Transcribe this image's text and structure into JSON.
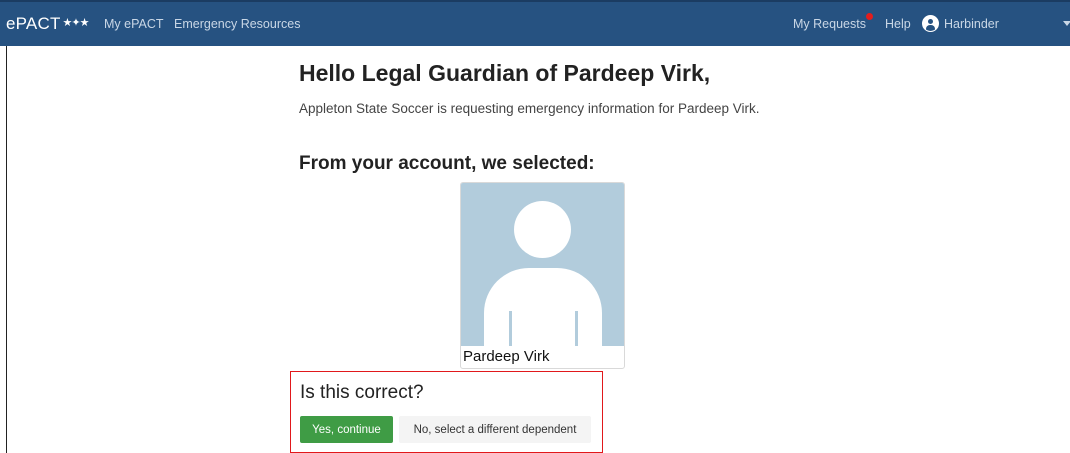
{
  "nav": {
    "brand": "ePACT",
    "brand_stars": "★✦★",
    "links": [
      "My ePACT",
      "Emergency Resources"
    ],
    "my_requests": "My Requests",
    "help": "Help",
    "user_name": "Harbinder",
    "colors": {
      "bar": "#265281",
      "notification": "#e31d1d"
    }
  },
  "main": {
    "greeting": "Hello Legal Guardian of Pardeep Virk,",
    "message": "Appleton State Soccer is requesting emergency information for Pardeep Virk.",
    "selected_heading": "From your account, we selected:",
    "dependent": {
      "name": "Pardeep Virk",
      "photo_icon": "person-placeholder-icon",
      "photo_bg": "#b2ccdc"
    }
  },
  "confirm": {
    "question": "Is this correct?",
    "yes_label": "Yes, continue",
    "no_label": "No, select a different dependent",
    "colors": {
      "yes": "#3f9c45",
      "highlight_border": "#e1181b"
    }
  }
}
